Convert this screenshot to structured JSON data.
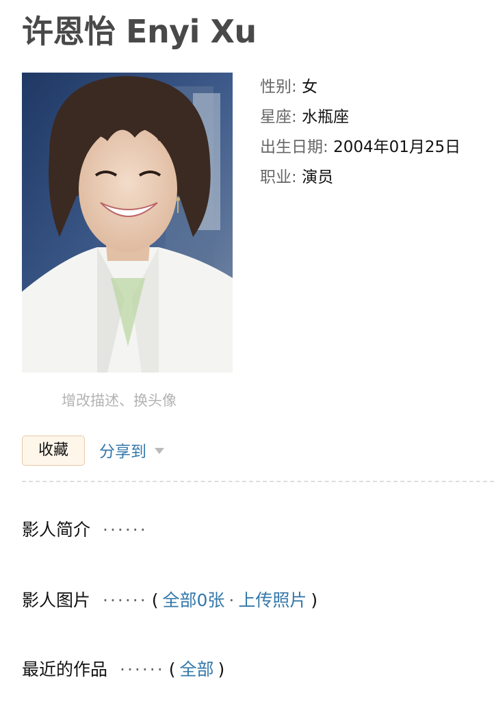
{
  "title": "许恩怡 Enyi Xu",
  "photo": {
    "edit_label": "增改描述、换头像"
  },
  "info": [
    {
      "key": "性别",
      "value": "女"
    },
    {
      "key": "星座",
      "value": "水瓶座"
    },
    {
      "key": "出生日期",
      "value": "2004年01月25日"
    },
    {
      "key": "职业",
      "value": "演员"
    }
  ],
  "actions": {
    "collect_label": "收藏",
    "share_label": "分享到"
  },
  "sections": {
    "intro": {
      "label": "影人简介",
      "dots": "······"
    },
    "photos": {
      "label": "影人图片",
      "dots": "······",
      "open_paren": "(",
      "all_link": "全部0张",
      "sep": "·",
      "upload_link": "上传照片",
      "close_paren": ")"
    },
    "works": {
      "label": "最近的作品",
      "dots": "······",
      "open_paren": "(",
      "all_link": "全部",
      "close_paren": ")"
    }
  },
  "colors": {
    "title": "#494949",
    "link": "#3377aa",
    "muted": "#b3b3b3",
    "button_bg": "#fff6ea",
    "button_border": "#e5c8a8"
  }
}
